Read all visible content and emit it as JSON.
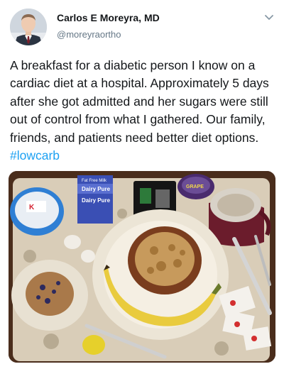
{
  "author": {
    "name": "Carlos E Moreyra, MD",
    "handle": "@moreyraortho"
  },
  "icons": {
    "menu": "chevron-down-icon",
    "avatar": "avatar"
  },
  "tweet": {
    "text": "A breakfast for a diabetic person I know on a cardiac diet at a hospital. Approximately 5 days after she got admitted and her sugars were still out of control from what I gathered. Our family, friends, and patients need better diet options. ",
    "hashtag": "#lowcarb"
  },
  "photo": {
    "subject": "hospital breakfast tray",
    "labels": {
      "milk_top": "Fat Free Milk",
      "milk_brand": "Dairy Pure",
      "milk_brand_2": "Dairy Pure",
      "jelly": "GRAPE"
    }
  },
  "colors": {
    "link": "#1da1f2",
    "handle": "#657786",
    "text": "#14171a"
  }
}
